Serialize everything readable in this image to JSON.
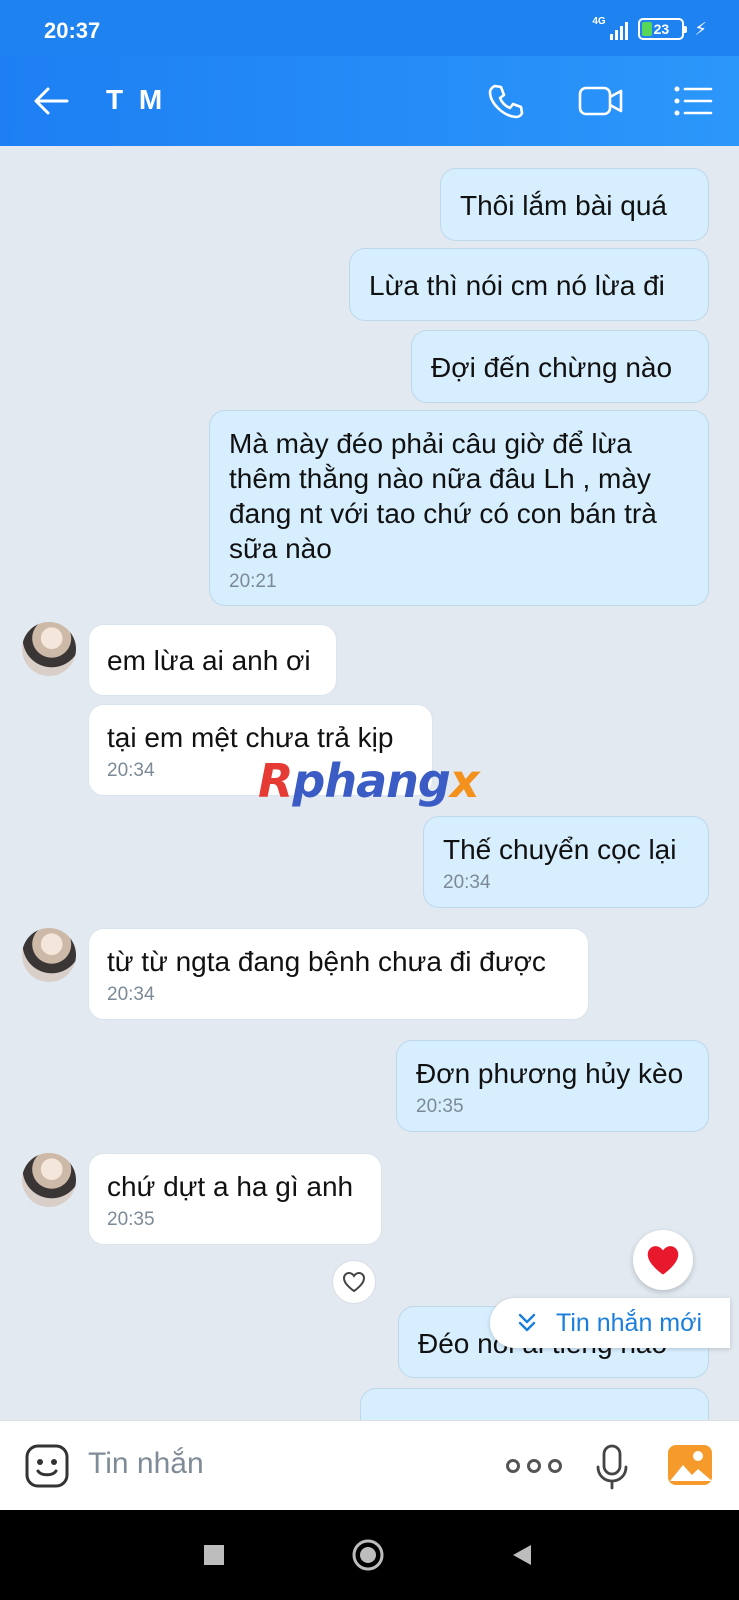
{
  "status_bar": {
    "time": "20:37",
    "network": "4G",
    "battery": "23",
    "charging": true
  },
  "header": {
    "title": "T M"
  },
  "messages": [
    {
      "text": "Thôi lắm bài quá"
    },
    {
      "text": "Lừa thì nói cm nó lừa đi"
    },
    {
      "text": "Đợi đến chừng nào"
    },
    {
      "text": "Mà mày đéo phải câu giờ để lừa\nthêm thằng nào nữa đâu Lh , mày\nđang nt với tao chứ có con bán trà\nsữa nào",
      "time": "20:21"
    },
    {
      "text": "em lừa ai anh ơi"
    },
    {
      "text": "tại em mệt chưa trả kịp",
      "time": "20:34"
    },
    {
      "text": "Thế chuyển cọc lại",
      "time": "20:34"
    },
    {
      "text": "từ từ ngta đang bệnh chưa đi được",
      "time": "20:34"
    },
    {
      "text": "Đơn phương hủy kèo",
      "time": "20:35"
    },
    {
      "text": "chứ dựt a ha gì anh",
      "time": "20:35"
    },
    {
      "text": "Đéo nói ai tiếng nào"
    }
  ],
  "new_message_label": "Tin nhắn mới",
  "watermark": {
    "part1": "R",
    "part2": "phang",
    "part3": "x"
  },
  "input": {
    "placeholder": "Tin nhắn"
  },
  "colors": {
    "header": "#1e82f0",
    "outgoing_bubble": "#d6eefe",
    "incoming_bubble": "#ffffff",
    "chat_bg": "#e2e9f1",
    "heart": "#e8192c"
  }
}
